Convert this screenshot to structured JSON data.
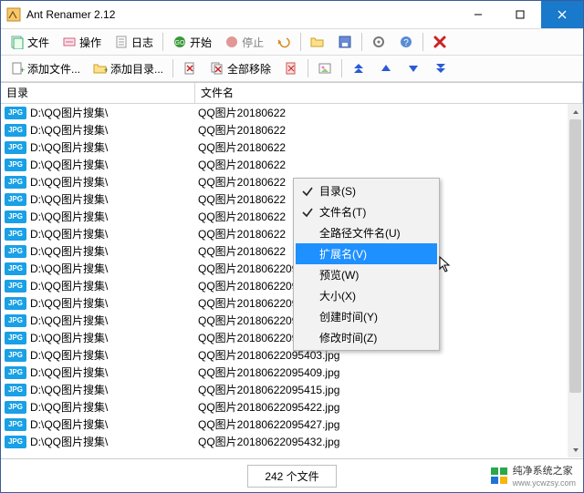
{
  "window": {
    "title": "Ant Renamer 2.12"
  },
  "toolbar1": {
    "files_label": "文件",
    "actions_label": "操作",
    "log_label": "日志",
    "start_label": "开始",
    "stop_label": "停止"
  },
  "toolbar2": {
    "add_files_label": "添加文件...",
    "add_folder_label": "添加目录...",
    "remove_all_label": "全部移除"
  },
  "columns": {
    "dir": "目录",
    "filename": "文件名"
  },
  "rows": [
    {
      "dir": "D:\\QQ图片搜集\\",
      "file": "QQ图片20180622"
    },
    {
      "dir": "D:\\QQ图片搜集\\",
      "file": "QQ图片20180622"
    },
    {
      "dir": "D:\\QQ图片搜集\\",
      "file": "QQ图片20180622"
    },
    {
      "dir": "D:\\QQ图片搜集\\",
      "file": "QQ图片20180622"
    },
    {
      "dir": "D:\\QQ图片搜集\\",
      "file": "QQ图片20180622"
    },
    {
      "dir": "D:\\QQ图片搜集\\",
      "file": "QQ图片20180622"
    },
    {
      "dir": "D:\\QQ图片搜集\\",
      "file": "QQ图片20180622"
    },
    {
      "dir": "D:\\QQ图片搜集\\",
      "file": "QQ图片20180622"
    },
    {
      "dir": "D:\\QQ图片搜集\\",
      "file": "QQ图片20180622"
    },
    {
      "dir": "D:\\QQ图片搜集\\",
      "file": "QQ图片20180622095330.jpg"
    },
    {
      "dir": "D:\\QQ图片搜集\\",
      "file": "QQ图片20180622095336.jpg"
    },
    {
      "dir": "D:\\QQ图片搜集\\",
      "file": "QQ图片20180622095342.jpg"
    },
    {
      "dir": "D:\\QQ图片搜集\\",
      "file": "QQ图片20180622095348.jpg"
    },
    {
      "dir": "D:\\QQ图片搜集\\",
      "file": "QQ图片20180622095357.jpg"
    },
    {
      "dir": "D:\\QQ图片搜集\\",
      "file": "QQ图片20180622095403.jpg"
    },
    {
      "dir": "D:\\QQ图片搜集\\",
      "file": "QQ图片20180622095409.jpg"
    },
    {
      "dir": "D:\\QQ图片搜集\\",
      "file": "QQ图片20180622095415.jpg"
    },
    {
      "dir": "D:\\QQ图片搜集\\",
      "file": "QQ图片20180622095422.jpg"
    },
    {
      "dir": "D:\\QQ图片搜集\\",
      "file": "QQ图片20180622095427.jpg"
    },
    {
      "dir": "D:\\QQ图片搜集\\",
      "file": "QQ图片20180622095432.jpg"
    }
  ],
  "badge_text": "JPG",
  "context_menu": {
    "dir": "目录(S)",
    "filename": "文件名(T)",
    "fullpath": "全路径文件名(U)",
    "ext": "扩展名(V)",
    "preview": "预览(W)",
    "size": "大小(X)",
    "ctime": "创建时间(Y)",
    "mtime": "修改时间(Z)"
  },
  "status": {
    "count_text": "242 个文件"
  },
  "watermark": {
    "brand": "纯净系统之家",
    "url": "www.ycwzsy.com"
  }
}
